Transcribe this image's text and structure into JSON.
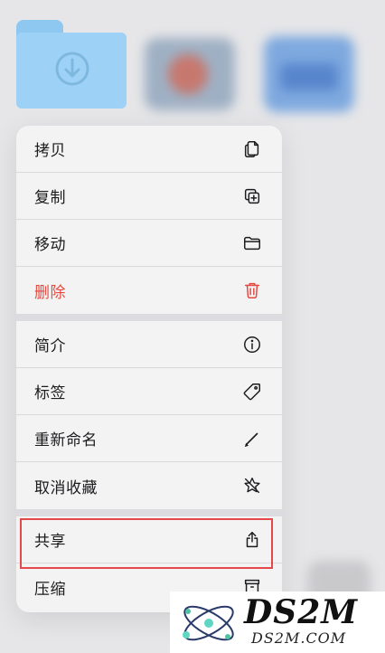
{
  "menu": {
    "items": [
      {
        "label": "拷贝",
        "icon": "copy-icon"
      },
      {
        "label": "复制",
        "icon": "duplicate-icon"
      },
      {
        "label": "移动",
        "icon": "folder-icon"
      },
      {
        "label": "删除",
        "icon": "trash-icon",
        "destructive": true
      },
      {
        "label": "简介",
        "icon": "info-icon"
      },
      {
        "label": "标签",
        "icon": "tag-icon"
      },
      {
        "label": "重新命名",
        "icon": "pencil-icon"
      },
      {
        "label": "取消收藏",
        "icon": "star-slash-icon"
      },
      {
        "label": "共享",
        "icon": "share-icon"
      },
      {
        "label": "压缩",
        "icon": "archive-icon"
      }
    ]
  },
  "folder": {
    "icon": "download-folder-icon"
  },
  "watermark": {
    "brand": "DS2M",
    "site": "DS2M.COM"
  },
  "colors": {
    "destructive": "#e5483f",
    "highlight": "#e5484a",
    "folder": "#9dd2f6"
  }
}
